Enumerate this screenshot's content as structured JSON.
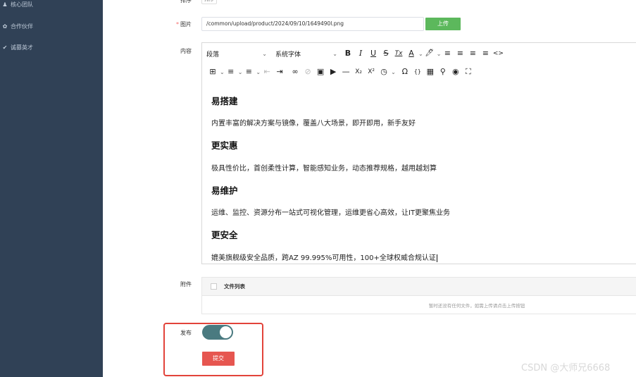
{
  "sidebar": {
    "items": [
      {
        "label": "核心团队",
        "icon": "team-icon"
      },
      {
        "label": "合作伙伴",
        "icon": "partner-icon"
      },
      {
        "label": "诚募英才",
        "icon": "recruit-icon"
      }
    ]
  },
  "form": {
    "top_label_partial": "排序",
    "top_value_partial": "排序",
    "image_label": "图片",
    "image_required_mark": "*",
    "image_path": "/common/upload/product/2024/09/10/1649490l.png",
    "upload_label": "上传",
    "content_label": "内容",
    "attachment_label": "附件",
    "publish_label": "发布",
    "publish_on": true,
    "submit_label": "提交"
  },
  "editor": {
    "paragraph_select": "段落",
    "font_select": "系统字体",
    "toolbar1_icons": [
      "B",
      "I",
      "U",
      "S",
      "Tx",
      "A",
      "🖊",
      "≡",
      "≡",
      "≡",
      "≡",
      "<>"
    ],
    "content": [
      {
        "type": "heading",
        "text": "易搭建"
      },
      {
        "type": "paragraph",
        "text": "内置丰富的解决方案与镜像，覆盖八大场景，即开即用，新手友好"
      },
      {
        "type": "heading",
        "text": "更实惠"
      },
      {
        "type": "paragraph",
        "text": "极具性价比，首创柔性计算，智能感知业务，动态推荐规格，越用越划算"
      },
      {
        "type": "heading",
        "text": "易维护"
      },
      {
        "type": "paragraph",
        "text": "运维、监控、资源分布一站式可视化管理，运维更省心高效，让IT更聚焦业务"
      },
      {
        "type": "heading",
        "text": "更安全"
      },
      {
        "type": "paragraph",
        "text": "媲美旗舰级安全品质，跨AZ 99.995%可用性，100+全球权威合规认证"
      }
    ]
  },
  "attachment": {
    "list_title": "文件列表",
    "empty_text": "暂时还没有任何文件，如需上传请点击上传按钮"
  },
  "watermark": "CSDN @大师兄6668",
  "colors": {
    "sidebar_bg": "#304156",
    "upload_btn": "#5cb85c",
    "toggle_on": "#4a7a80",
    "submit_btn": "#e65650",
    "highlight_border": "#e2433a"
  }
}
